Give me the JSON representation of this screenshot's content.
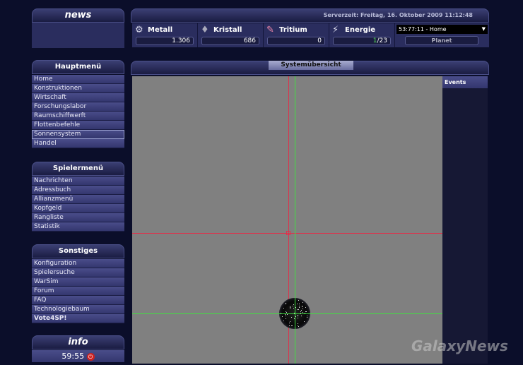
{
  "news": {
    "title": "news"
  },
  "header": {
    "server_time": "Serverzeit: Freitag, 16. Oktober 2009 11:12:48"
  },
  "resources": [
    {
      "name": "Metall",
      "value": "1.306",
      "icon": "metal-icon"
    },
    {
      "name": "Kristall",
      "value": "686",
      "icon": "crystal-icon"
    },
    {
      "name": "Tritium",
      "value": "0",
      "icon": "tritium-icon"
    },
    {
      "name": "Energie",
      "value_used": "1",
      "value_total": "/23",
      "icon": "energy-icon"
    }
  ],
  "planet": {
    "selected": "53:77:11 - Home",
    "button": "Planet"
  },
  "main": {
    "title": "Systemübersicht",
    "events_label": "Events"
  },
  "hauptmenu": {
    "title": "Hauptmenü",
    "items": [
      "Home",
      "Konstruktionen",
      "Wirtschaft",
      "Forschungslabor",
      "Raumschiffwerft",
      "Flottenbefehle",
      "Sonnensystem",
      "Handel"
    ]
  },
  "spielermenu": {
    "title": "Spielermenü",
    "items": [
      "Nachrichten",
      "Adressbuch",
      "Allianzmenü",
      "Kopfgeld",
      "Rangliste",
      "Statistik"
    ]
  },
  "sonstiges": {
    "title": "Sonstiges",
    "items": [
      "Konfiguration",
      "Spielersuche",
      "WarSim",
      "Forum",
      "FAQ",
      "Technologiebaum",
      "Vote4SP!"
    ]
  },
  "info": {
    "title": "info",
    "timer": "59:55"
  },
  "watermark": "GalaxyNews",
  "colors": {
    "red_line": "#e0304a",
    "green_line": "#40e040",
    "map_bg": "#808080"
  }
}
